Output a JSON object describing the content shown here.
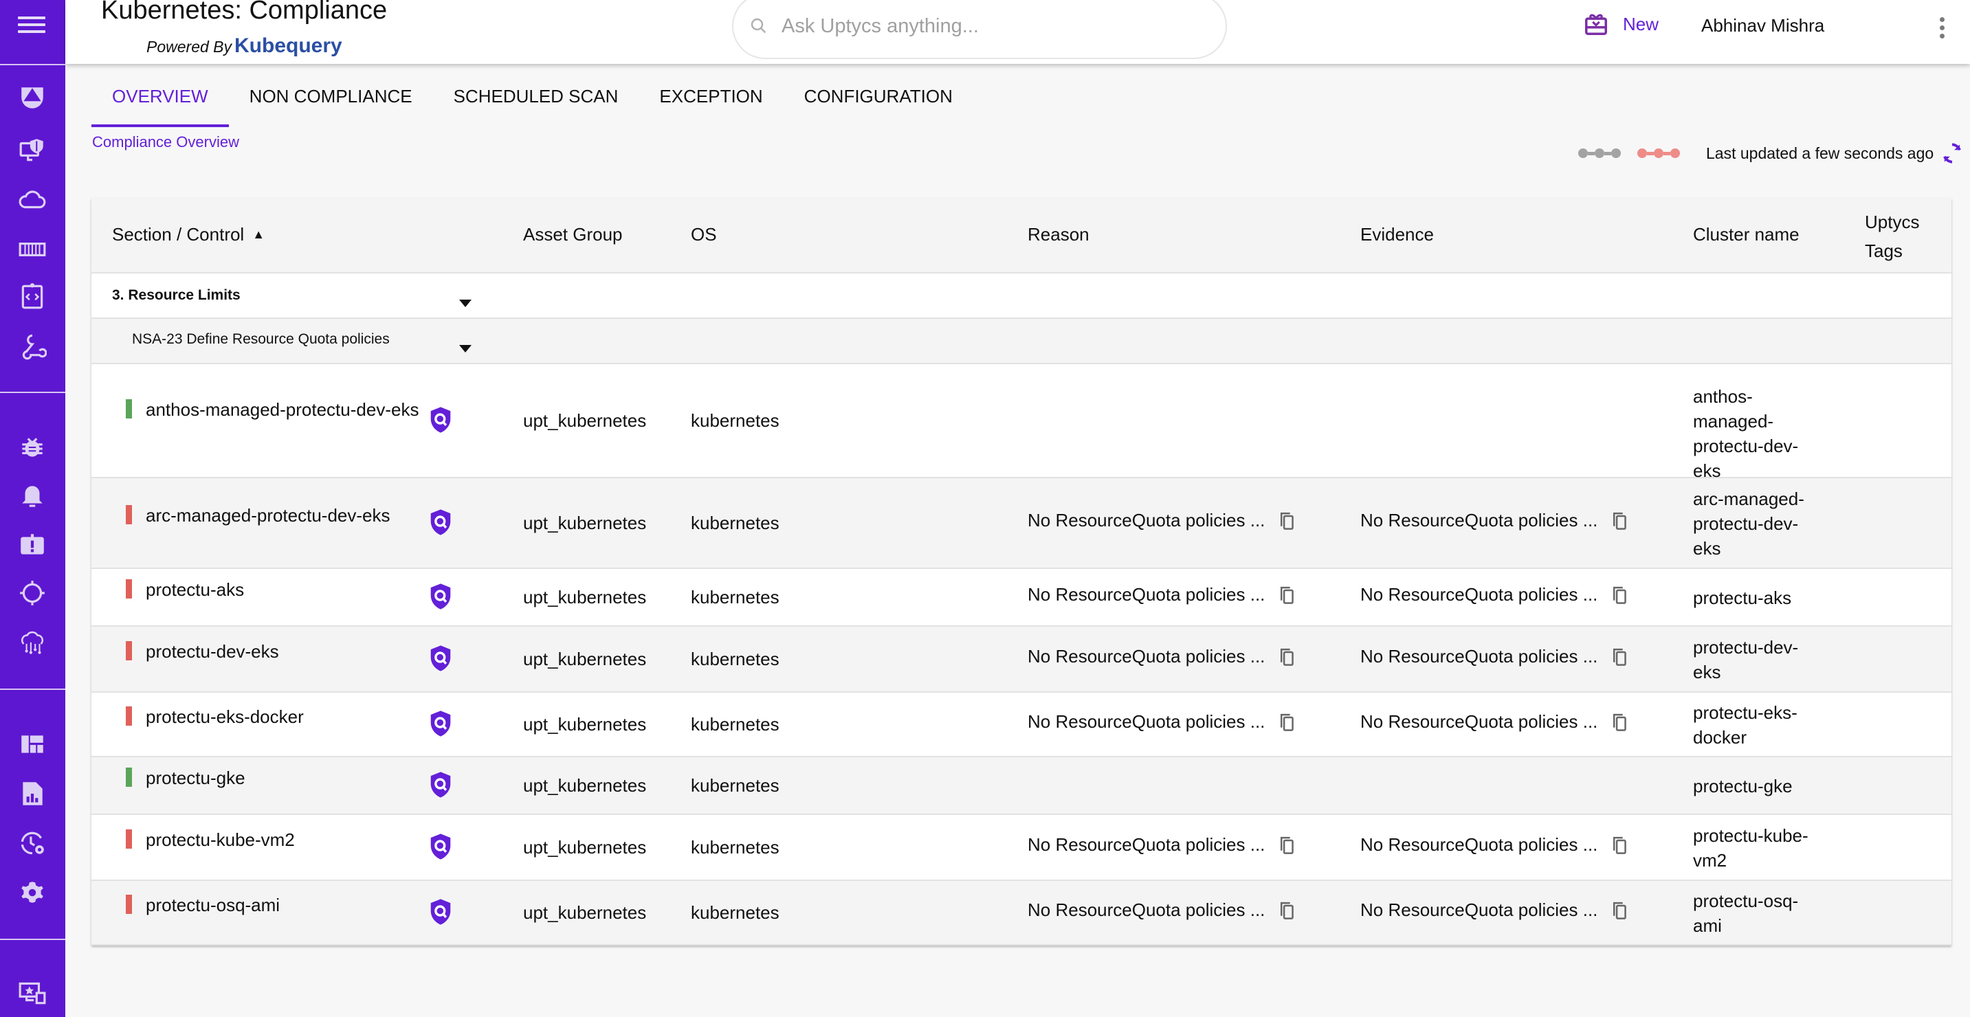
{
  "app": {
    "title": "Kubernetes: Compliance",
    "powered_by_prefix": "Powered By",
    "powered_by_brand": "Kubequery"
  },
  "search": {
    "placeholder": "Ask Uptycs anything..."
  },
  "header": {
    "new_label": "New",
    "user_name": "Abhinav Mishra"
  },
  "sidebar": {
    "groups": [
      [
        "uptycs-logo-icon",
        "endpoint-security-icon",
        "cloud-icon",
        "container-icon",
        "code-review-icon",
        "integrations-icon"
      ],
      [
        "vulnerability-bug-icon",
        "alerts-bell-icon",
        "incident-icon",
        "detection-target-icon",
        "ai-brain-icon"
      ],
      [
        "dashboard-icon",
        "reports-icon",
        "scheduled-history-icon",
        "settings-gear-icon"
      ],
      [
        "device-favorites-icon"
      ]
    ]
  },
  "tabs": [
    {
      "label": "OVERVIEW",
      "active": true
    },
    {
      "label": "NON COMPLIANCE",
      "active": false
    },
    {
      "label": "SCHEDULED SCAN",
      "active": false
    },
    {
      "label": "EXCEPTION",
      "active": false
    },
    {
      "label": "CONFIGURATION",
      "active": false
    }
  ],
  "breadcrumb": "Compliance Overview",
  "status": {
    "last_updated": "Last updated a few seconds ago",
    "colors": {
      "pass_dots": "#a3a3a3",
      "fail_dots": "#ee8c87"
    }
  },
  "table": {
    "columns": {
      "section_control": "Section / Control",
      "asset_group": "Asset Group",
      "os": "OS",
      "reason": "Reason",
      "evidence": "Evidence",
      "cluster_name": "Cluster name",
      "tags_line1": "Uptycs",
      "tags_line2": "Tags"
    },
    "section": "3. Resource Limits",
    "control": "NSA-23 Define Resource Quota policies",
    "colors": {
      "pass": "#5aa55a",
      "fail": "#e0605a",
      "accent": "#6320d8"
    },
    "rows": [
      {
        "asset": "anthos-managed-protectu-dev-eks",
        "status": "pass",
        "asset_group": "upt_kubernetes",
        "os": "kubernetes",
        "reason": "",
        "evidence": "",
        "cluster": "anthos-managed-protectu-dev-eks",
        "tags": ""
      },
      {
        "asset": "arc-managed-protectu-dev-eks",
        "status": "fail",
        "asset_group": "upt_kubernetes",
        "os": "kubernetes",
        "reason": "No ResourceQuota policies ...",
        "evidence": "No ResourceQuota policies ...",
        "cluster": "arc-managed-protectu-dev-eks",
        "tags": ""
      },
      {
        "asset": "protectu-aks",
        "status": "fail",
        "asset_group": "upt_kubernetes",
        "os": "kubernetes",
        "reason": "No ResourceQuota policies ...",
        "evidence": "No ResourceQuota policies ...",
        "cluster": "protectu-aks",
        "tags": ""
      },
      {
        "asset": "protectu-dev-eks",
        "status": "fail",
        "asset_group": "upt_kubernetes",
        "os": "kubernetes",
        "reason": "No ResourceQuota policies ...",
        "evidence": "No ResourceQuota policies ...",
        "cluster": "protectu-dev-eks",
        "tags": ""
      },
      {
        "asset": "protectu-eks-docker",
        "status": "fail",
        "asset_group": "upt_kubernetes",
        "os": "kubernetes",
        "reason": "No ResourceQuota policies ...",
        "evidence": "No ResourceQuota policies ...",
        "cluster": "protectu-eks-docker",
        "tags": ""
      },
      {
        "asset": "protectu-gke",
        "status": "pass",
        "asset_group": "upt_kubernetes",
        "os": "kubernetes",
        "reason": "",
        "evidence": "",
        "cluster": "protectu-gke",
        "tags": ""
      },
      {
        "asset": "protectu-kube-vm2",
        "status": "fail",
        "asset_group": "upt_kubernetes",
        "os": "kubernetes",
        "reason": "No ResourceQuota policies ...",
        "evidence": "No ResourceQuota policies ...",
        "cluster": "protectu-kube-vm2",
        "tags": ""
      },
      {
        "asset": "protectu-osq-ami",
        "status": "fail",
        "asset_group": "upt_kubernetes",
        "os": "kubernetes",
        "reason": "No ResourceQuota policies ...",
        "evidence": "No ResourceQuota policies ...",
        "cluster": "protectu-osq-ami",
        "tags": ""
      }
    ]
  }
}
